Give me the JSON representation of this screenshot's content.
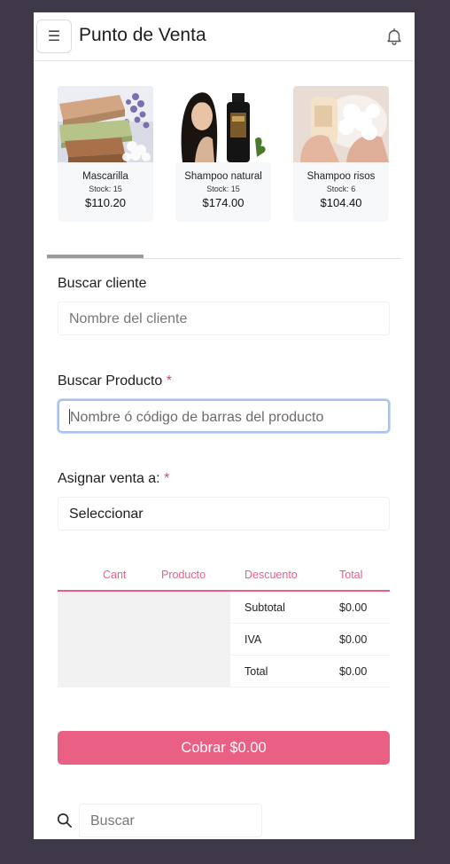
{
  "header": {
    "menu_icon": "☰",
    "title": "Punto de Venta"
  },
  "products": [
    {
      "name": "Mascarilla",
      "stock": "Stock: 15",
      "price": "$110.20"
    },
    {
      "name": "Shampoo natural",
      "stock": "Stock: 15",
      "price": "$174.00"
    },
    {
      "name": "Shampoo risos",
      "stock": "Stock: 6",
      "price": "$104.40"
    }
  ],
  "form": {
    "client_label": "Buscar cliente",
    "client_placeholder": "Nombre del cliente",
    "product_label": "Buscar Producto",
    "product_placeholder": "Nombre ó código de barras del producto",
    "assign_label": "Asignar venta a:",
    "assign_value": "Seleccionar",
    "required_mark": "*"
  },
  "table": {
    "headers": [
      "Cant",
      "Producto",
      "Descuento",
      "Total"
    ],
    "summary": [
      {
        "label": "Subtotal",
        "value": "$0.00"
      },
      {
        "label": "IVA",
        "value": "$0.00"
      },
      {
        "label": "Total",
        "value": "$0.00"
      }
    ]
  },
  "charge_button": "Cobrar $0.00",
  "bottom_search": {
    "placeholder": "Buscar"
  },
  "colors": {
    "accent": "#ea5f84",
    "background": "#3e3849",
    "focus": "#a9c1ec"
  },
  "icons": [
    "menu-icon",
    "bell-icon",
    "search-icon"
  ]
}
